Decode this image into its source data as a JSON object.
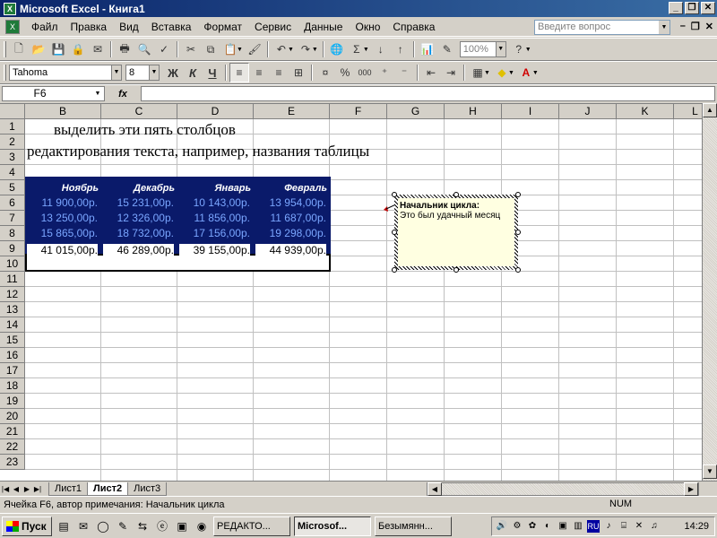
{
  "window": {
    "title": "Microsoft Excel - Книга1",
    "app_icon": "excel-icon"
  },
  "menu": {
    "items": [
      "Файл",
      "Правка",
      "Вид",
      "Вставка",
      "Формат",
      "Сервис",
      "Данные",
      "Окно",
      "Справка"
    ],
    "help_placeholder": "Введите вопрос"
  },
  "toolbar": {
    "zoom": "100%",
    "font_name": "Tahoma",
    "font_size": "8",
    "bold": "Ж",
    "italic": "К",
    "underline": "Ч",
    "sum_symbol": "Σ",
    "percent": "%",
    "thousands": "000",
    "help_icon": "?"
  },
  "formula_bar": {
    "cell_ref": "F6",
    "fx": "fx",
    "value": ""
  },
  "grid": {
    "columns": [
      "B",
      "C",
      "D",
      "E",
      "F",
      "G",
      "H",
      "I",
      "J",
      "K",
      "L"
    ],
    "rows": [
      "1",
      "2",
      "3",
      "4",
      "5",
      "6",
      "7",
      "8",
      "9",
      "10",
      "11",
      "12",
      "13",
      "14",
      "15",
      "16",
      "17",
      "18",
      "19",
      "20",
      "21",
      "22",
      "23"
    ],
    "row1_text": "выделить эти пять столбцов",
    "row2_text": "редактирования текста, например, названия таблицы",
    "headers": [
      "Ноябрь",
      "Декабрь",
      "Январь",
      "Февраль"
    ],
    "data_rows": [
      [
        "11 900,00р.",
        "15 231,00р.",
        "10 143,00р.",
        "13 954,00р."
      ],
      [
        "13 250,00р.",
        "12 326,00р.",
        "11 856,00р.",
        "11 687,00р."
      ],
      [
        "15 865,00р.",
        "18 732,00р.",
        "17 156,00р.",
        "19 298,00р."
      ]
    ],
    "totals": [
      "41 015,00р.",
      "46 289,00р.",
      "39 155,00р.",
      "44 939,00р."
    ]
  },
  "comment": {
    "title": "Начальник цикла:",
    "text": "Это был удачный месяц"
  },
  "sheets": {
    "tabs": [
      "Лист1",
      "Лист2",
      "Лист3"
    ],
    "active": "Лист2"
  },
  "status": {
    "text": "Ячейка F6, автор примечания: Начальник цикла",
    "num": "NUM"
  },
  "taskbar": {
    "start": "Пуск",
    "tasks": [
      "РЕДАКТО...",
      "Microsof...",
      "Безымянн..."
    ],
    "clock": "14:29",
    "lang": "RU"
  },
  "colors": {
    "header_fill": "#0a1a6a",
    "data_text": "#7aa6ff",
    "comment_bg": "#ffffe1"
  }
}
